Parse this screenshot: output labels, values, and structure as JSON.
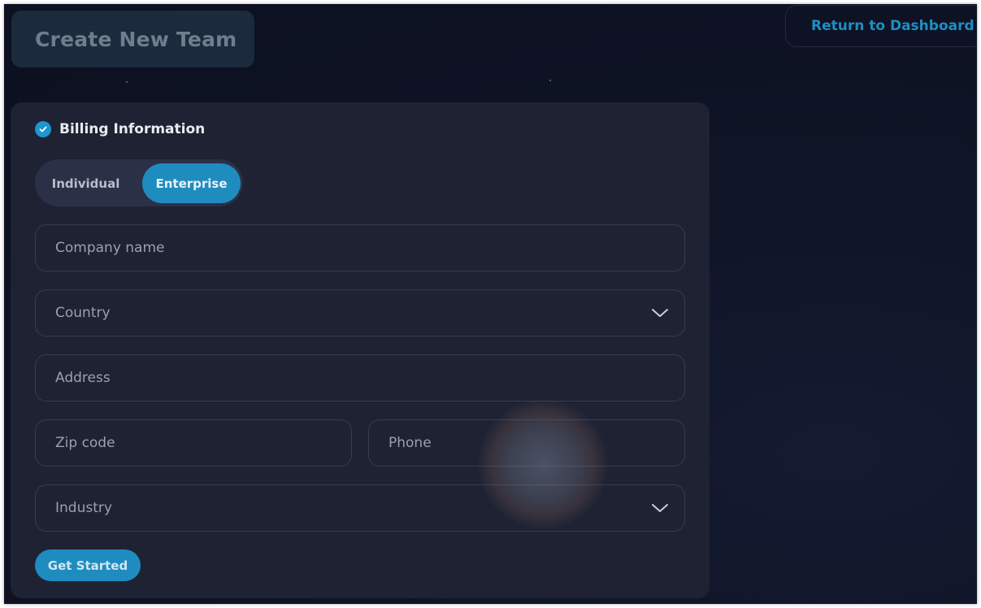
{
  "header": {
    "title": "Create New Team",
    "return_label": "Return to Dashboard"
  },
  "billing": {
    "section_title": "Billing Information",
    "account_types": [
      "Individual",
      "Enterprise"
    ],
    "selected_account_type": "Enterprise"
  },
  "form": {
    "company_name_placeholder": "Company name",
    "country_label": "Country",
    "address_placeholder": "Address",
    "zip_placeholder": "Zip code",
    "phone_placeholder": "Phone",
    "industry_label": "Industry",
    "submit_label": "Get Started"
  },
  "colors": {
    "accent": "#1f8cbf",
    "card": "#1e2233",
    "background": "#0f1426"
  },
  "icons": {
    "section_status": "check-circle-icon",
    "select_caret": "chevron-down-icon"
  }
}
